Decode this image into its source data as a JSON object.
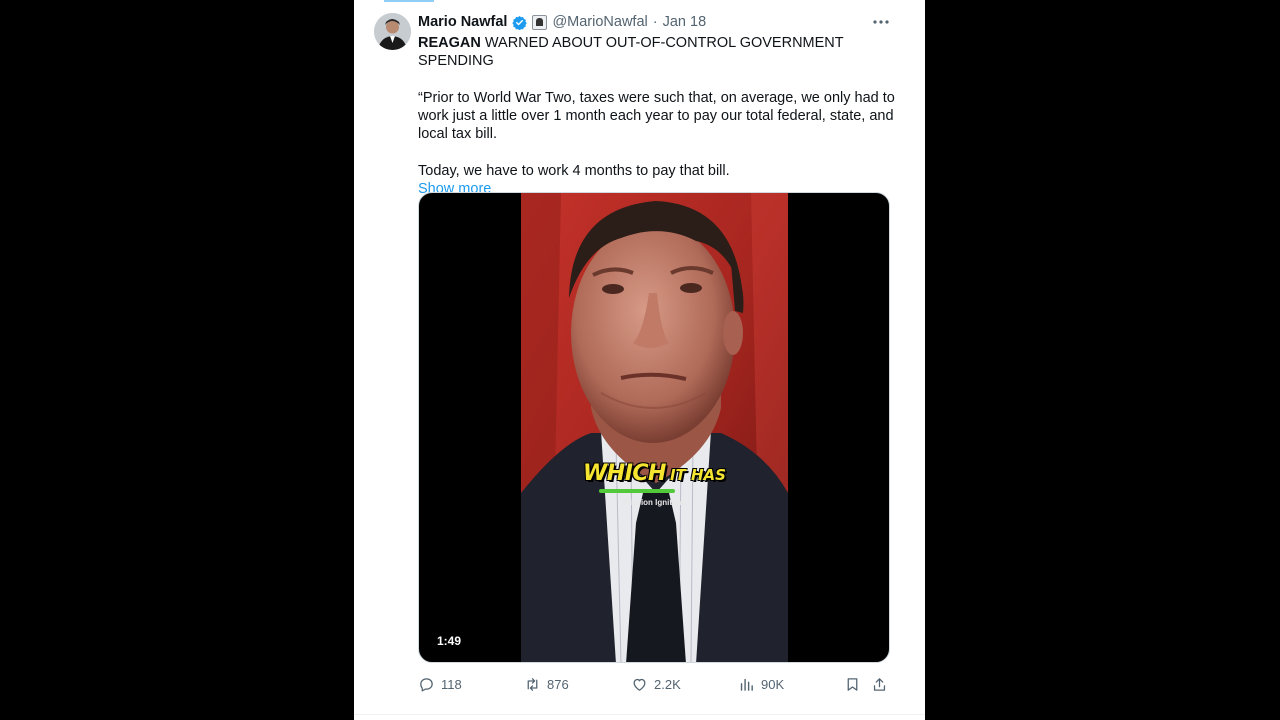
{
  "tweet": {
    "author_name": "Mario Nawfal",
    "handle": "@MarioNawfal",
    "separator": "·",
    "date": "Jan 18",
    "more_label": "•••",
    "headline_bold": "REAGAN",
    "headline_rest": " WARNED ABOUT OUT-OF-CONTROL GOVERNMENT SPENDING",
    "paragraph1": "“Prior to World War Two, taxes were such that, on average, we only had to work just a little over 1 month each year to pay our total federal, state, and local tax bill.",
    "paragraph2": "Today, we have to work 4 months to pay that bill.",
    "show_more": "Show more"
  },
  "media": {
    "caption_big": "WHICH",
    "caption_small": "IT HAS",
    "watermark": "Mission Ignitline",
    "duration": "1:49"
  },
  "actions": {
    "replies": "118",
    "reposts": "876",
    "likes": "2.2K",
    "views": "90K"
  },
  "icons": {
    "verified": "verified-badge-icon",
    "affiliation": "affiliation-badge-icon",
    "reply": "reply-icon",
    "repost": "repost-icon",
    "like": "heart-icon",
    "views": "views-icon",
    "bookmark": "bookmark-icon",
    "share": "share-icon"
  },
  "colors": {
    "accent": "#1d9bf0",
    "text": "#0f1419",
    "muted": "#536471"
  }
}
